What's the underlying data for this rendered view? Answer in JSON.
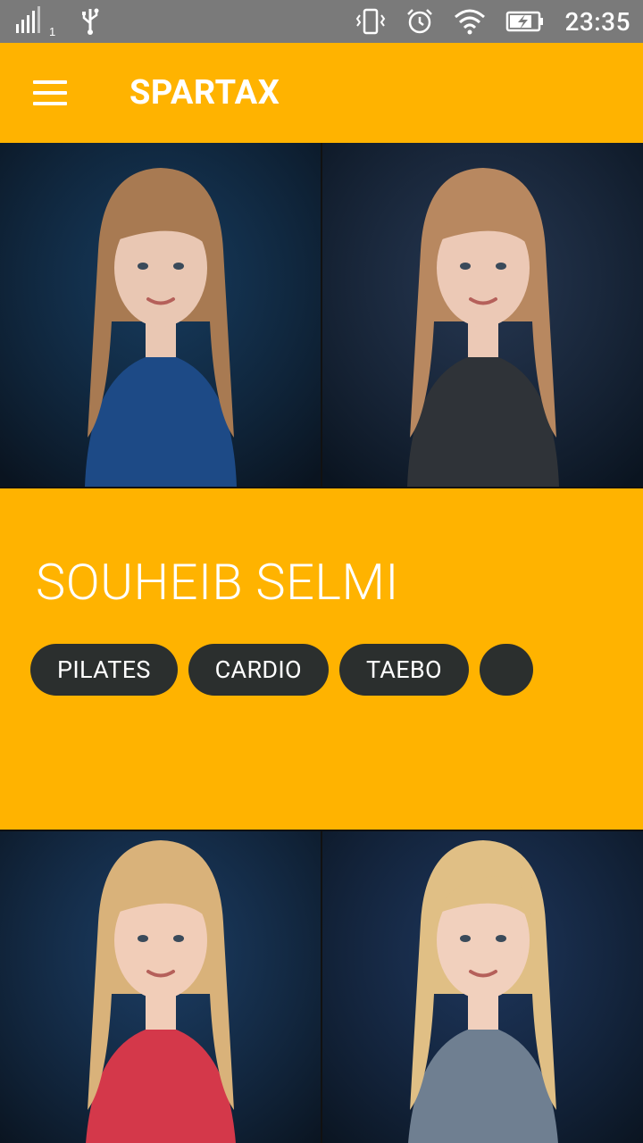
{
  "status_bar": {
    "signal_icon": "signal-icon",
    "sim_label": "1",
    "usb_icon": "usb-icon",
    "vibrate_icon": "vibrate-icon",
    "alarm_icon": "alarm-icon",
    "wifi_icon": "wifi-icon",
    "battery_icon": "battery-charging-icon",
    "time": "23:35"
  },
  "app_bar": {
    "menu_icon": "hamburger-menu-icon",
    "title": "SPARTAX"
  },
  "trainer": {
    "name": "SOUHEIB SELMI",
    "tags": [
      "PILATES",
      "CARDIO",
      "TAEBO",
      ""
    ]
  },
  "photos": [
    {
      "name": "trainer-photo-1",
      "background": "#163a5c",
      "hair": "#a87a52",
      "shirt": "#1d4a86",
      "skin": "#e9c7b3"
    },
    {
      "name": "trainer-photo-2",
      "background": "#253650",
      "hair": "#b88860",
      "shirt": "#2f3338",
      "skin": "#ecc9b6"
    },
    {
      "name": "trainer-photo-3",
      "background": "#1b3c62",
      "hair": "#d9b27a",
      "shirt": "#d4384a",
      "skin": "#f1cdb8"
    },
    {
      "name": "trainer-photo-4",
      "background": "#1d355a",
      "hair": "#e0bf85",
      "shirt": "#6f7f91",
      "skin": "#f1d0bd"
    }
  ],
  "colors": {
    "accent": "#ffb300",
    "chip": "#2b2f2e",
    "status_bar": "#7a7a7a"
  }
}
